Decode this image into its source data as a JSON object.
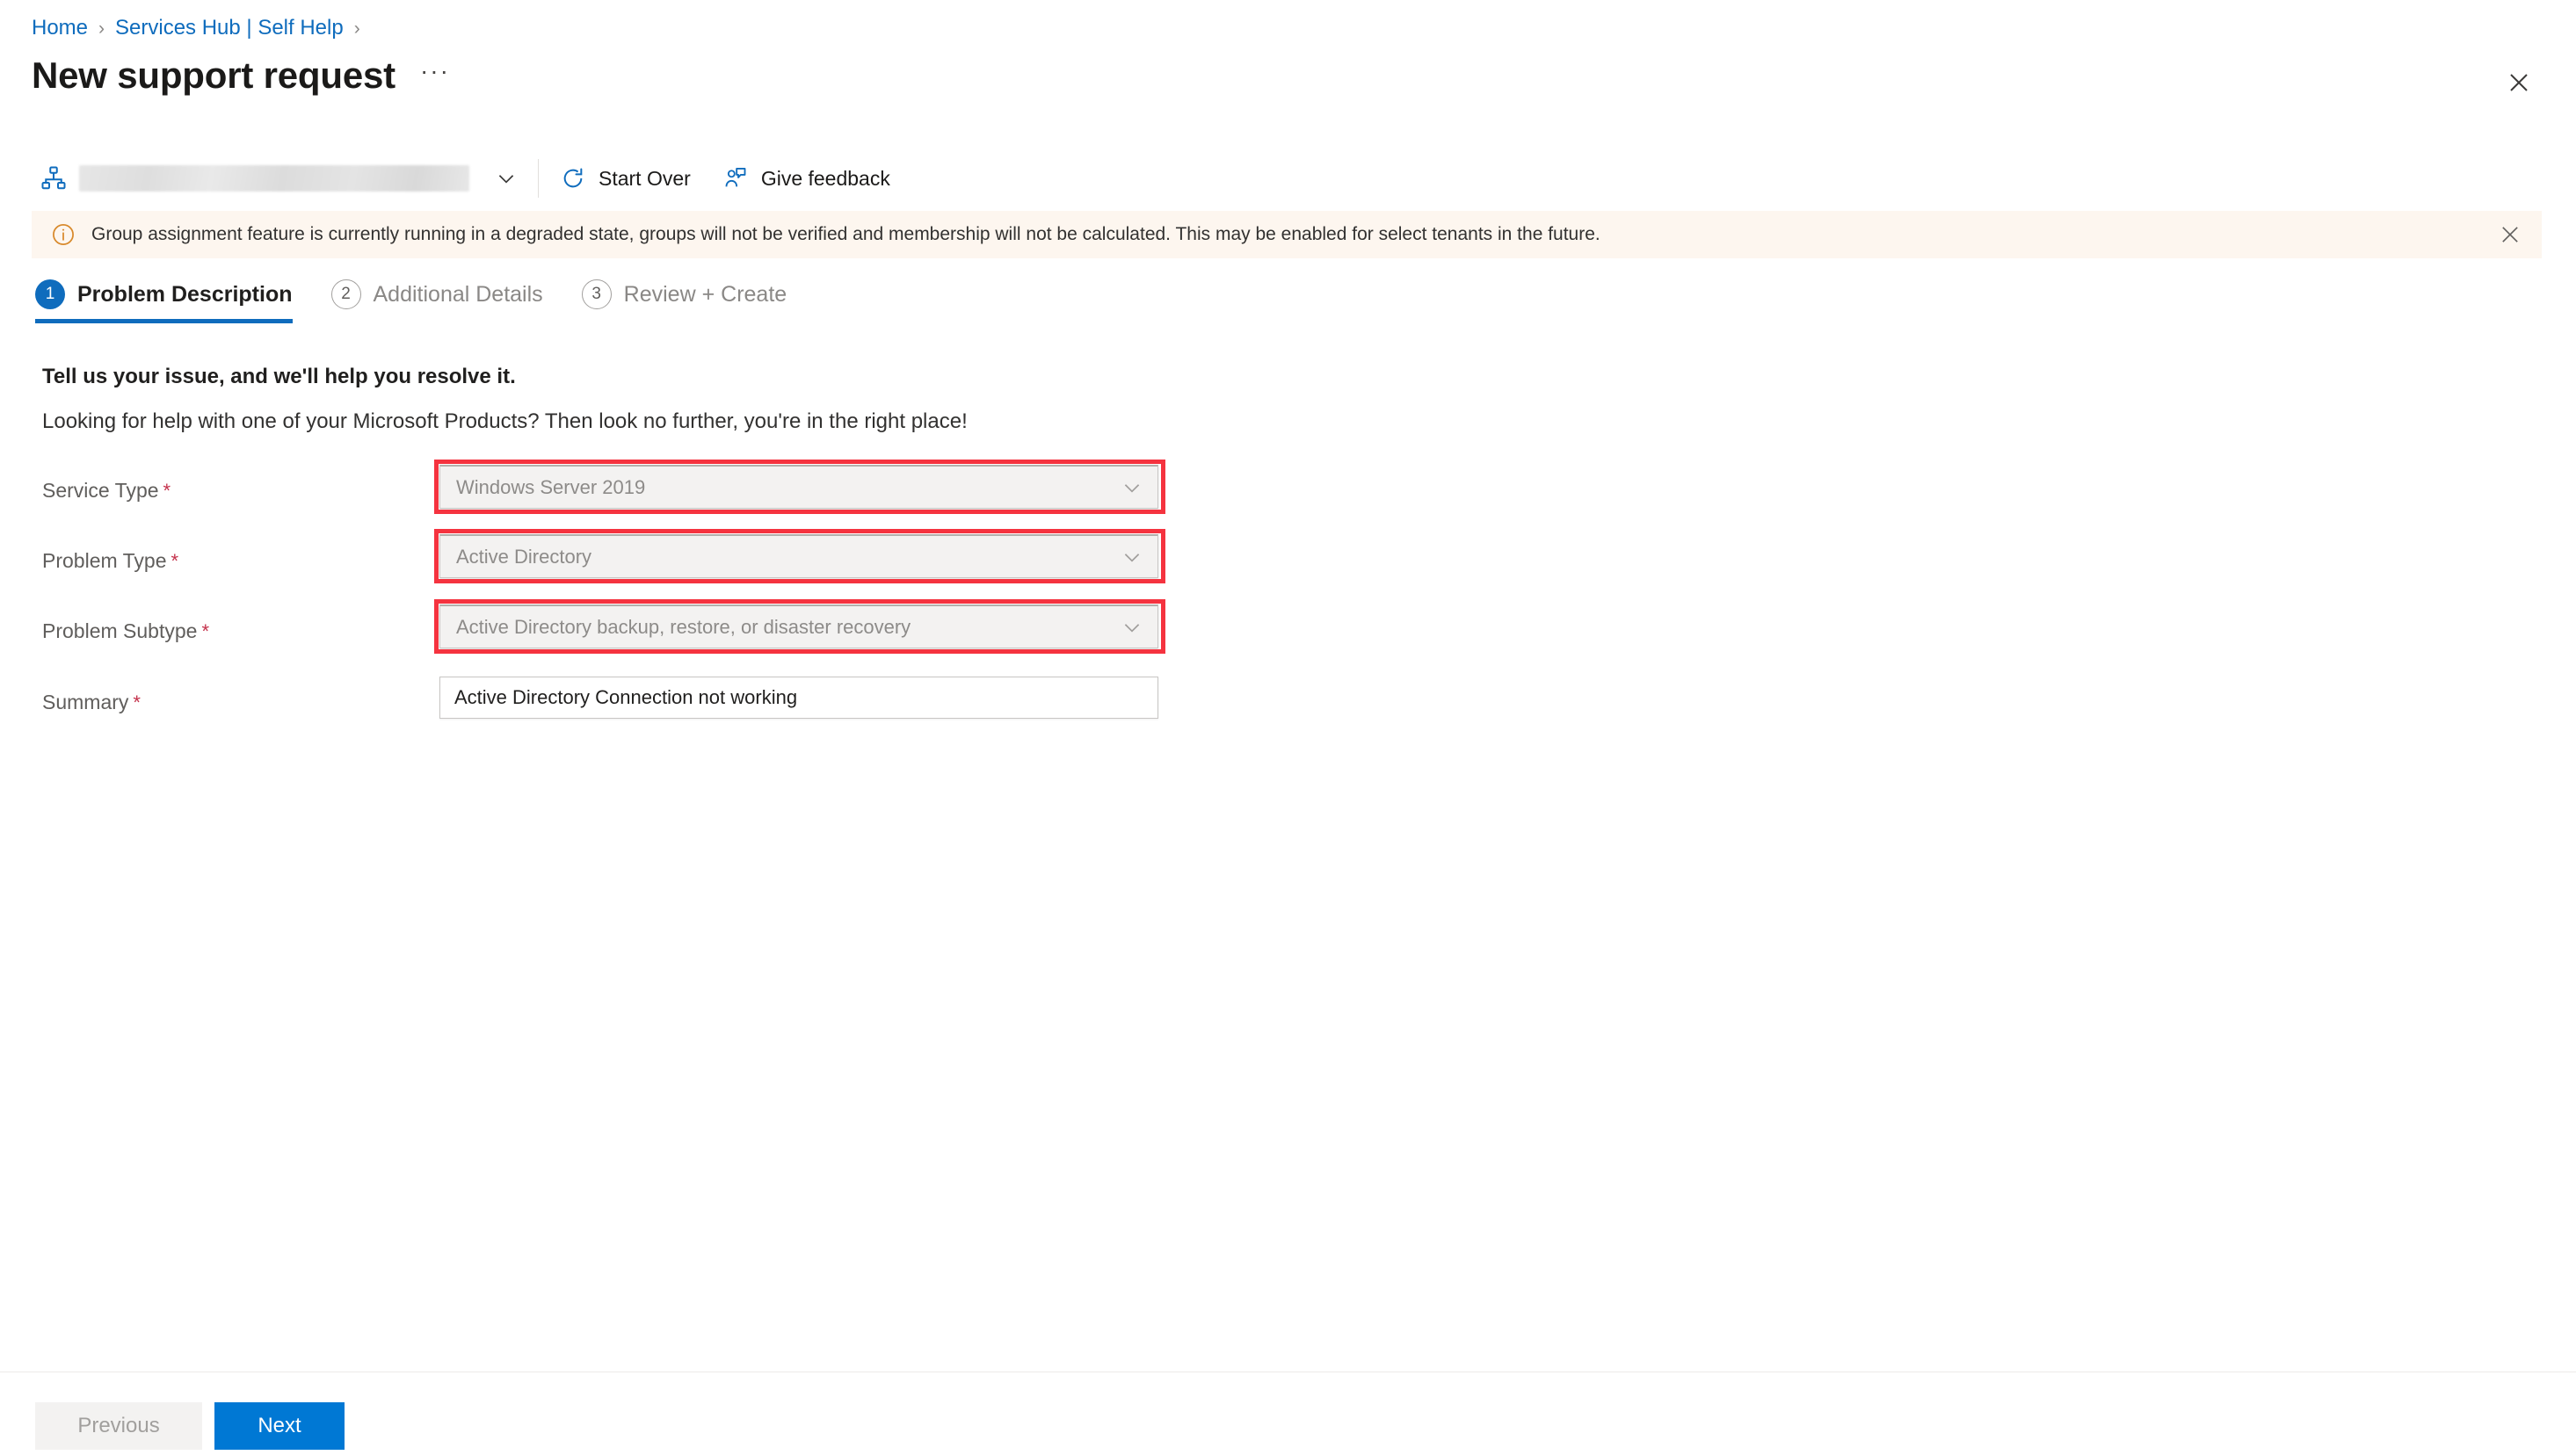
{
  "breadcrumb": {
    "items": [
      {
        "label": "Home"
      },
      {
        "label": "Services Hub | Self Help"
      }
    ],
    "separator": "›"
  },
  "header": {
    "title": "New support request",
    "more_label": "···",
    "close_icon": "close-icon"
  },
  "command_bar": {
    "org_icon": "org-hierarchy-icon",
    "tenant_value": "",
    "tenant_chevron_icon": "chevron-down-icon",
    "start_over": {
      "label": "Start Over",
      "icon": "refresh-icon"
    },
    "give_feedback": {
      "label": "Give feedback",
      "icon": "person-feedback-icon"
    }
  },
  "banner": {
    "icon": "info-icon",
    "message": "Group assignment feature is currently running in a degraded state, groups will not be verified and membership will not be calculated. This may be enabled for select tenants in the future.",
    "close_icon": "close-icon",
    "background": "#fdf6ef",
    "accent": "#d8892b"
  },
  "steps": [
    {
      "number": "1",
      "label": "Problem Description",
      "state": "active"
    },
    {
      "number": "2",
      "label": "Additional Details",
      "state": "idle"
    },
    {
      "number": "3",
      "label": "Review + Create",
      "state": "idle"
    }
  ],
  "content": {
    "lead_strong": "Tell us your issue, and we'll help you resolve it.",
    "lead_sub": "Looking for help with one of your Microsoft Products? Then look no further, you're in the right place!"
  },
  "form": {
    "required_mark": "*",
    "fields": [
      {
        "label": "Service Type",
        "value": "Windows Server 2019",
        "type": "dropdown",
        "required": true,
        "highlighted": true,
        "chevron_icon": "chevron-down-icon"
      },
      {
        "label": "Problem Type",
        "value": "Active Directory",
        "type": "dropdown",
        "required": true,
        "highlighted": true,
        "chevron_icon": "chevron-down-icon"
      },
      {
        "label": "Problem Subtype",
        "value": "Active Directory backup, restore, or disaster recovery",
        "type": "dropdown",
        "required": true,
        "highlighted": true,
        "chevron_icon": "chevron-down-icon"
      },
      {
        "label": "Summary",
        "value": "Active Directory Connection not working",
        "placeholder": "",
        "type": "text",
        "required": true,
        "highlighted": false
      }
    ]
  },
  "footer": {
    "previous_label": "Previous",
    "next_label": "Next"
  },
  "colors": {
    "accent": "#0f6cbd",
    "primary_button": "#0078d4",
    "highlight": "#f5333f",
    "required": "#c4314b"
  }
}
